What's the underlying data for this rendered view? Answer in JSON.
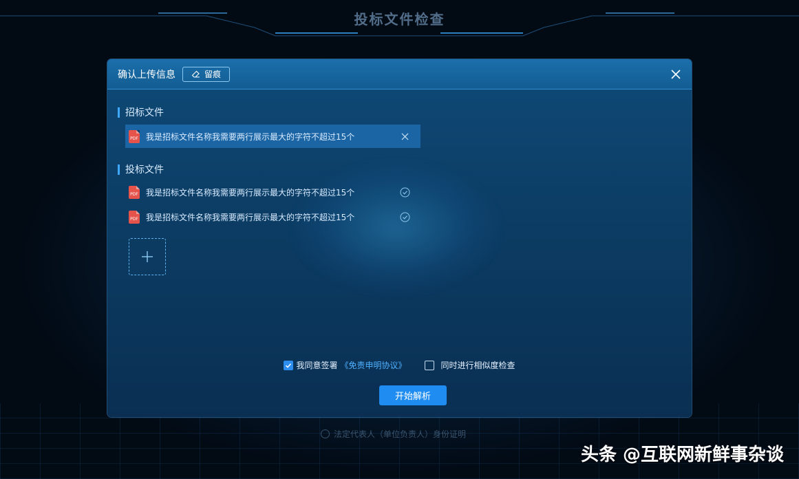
{
  "page": {
    "title": "投标文件检查",
    "footer_hint": "法定代表人（单位负责人）身份证明",
    "watermark": "头条 @互联网新鲜事杂谈"
  },
  "dialog": {
    "title": "确认上传信息",
    "trace_button": {
      "label": "留痕",
      "icon": "eraser-icon"
    },
    "close_icon": "close-icon",
    "sections": {
      "tender": {
        "title": "招标文件",
        "files": [
          {
            "name": "我是招标文件名称我需要两行展示最大的字符不超过15个",
            "icon": "pdf-icon",
            "pdf_text": "PDF",
            "action_icon": "remove-icon"
          }
        ]
      },
      "bid": {
        "title": "投标文件",
        "files": [
          {
            "name": "我是招标文件名称我需要两行展示最大的字符不超过15个",
            "icon": "pdf-icon",
            "pdf_text": "PDF",
            "status_icon": "check-circle-icon"
          },
          {
            "name": "我是招标文件名称我需要两行展示最大的字符不超过15个",
            "icon": "pdf-icon",
            "pdf_text": "PDF",
            "status_icon": "check-circle-icon"
          }
        ],
        "add_icon": "plus-icon"
      }
    },
    "agreement": {
      "checked": true,
      "prefix": "我同意签署",
      "link": "《免责申明协议》"
    },
    "similarity": {
      "checked": false,
      "label": "同时进行相似度检查"
    },
    "start_button": "开始解析"
  },
  "colors": {
    "accent": "#1e8cf0",
    "link": "#4fb0ff",
    "pdf_red": "#e5534b",
    "header_blue": "#1b6fab"
  }
}
